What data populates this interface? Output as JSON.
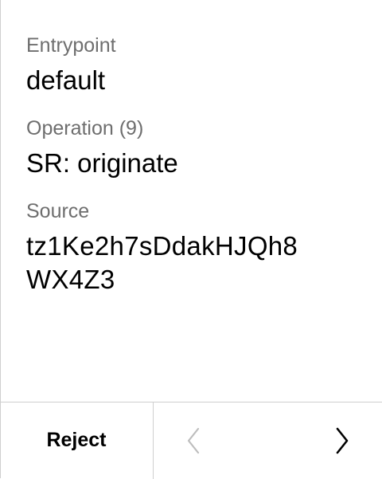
{
  "fields": {
    "entrypoint": {
      "label": "Entrypoint",
      "value": "default"
    },
    "operation": {
      "label": "Operation (9)",
      "value": "SR: originate"
    },
    "source": {
      "label": "Source",
      "value_line1": "tz1Ke2h7sDdakHJQh8",
      "value_line2": "WX4Z3"
    }
  },
  "footer": {
    "reject_label": "Reject",
    "prev_icon": "chevron-left-icon",
    "next_icon": "chevron-right-icon"
  },
  "colors": {
    "label": "#6e6e6e",
    "value": "#000000",
    "divider": "#cfcfcf",
    "disabled_icon": "#bdbdbd"
  }
}
